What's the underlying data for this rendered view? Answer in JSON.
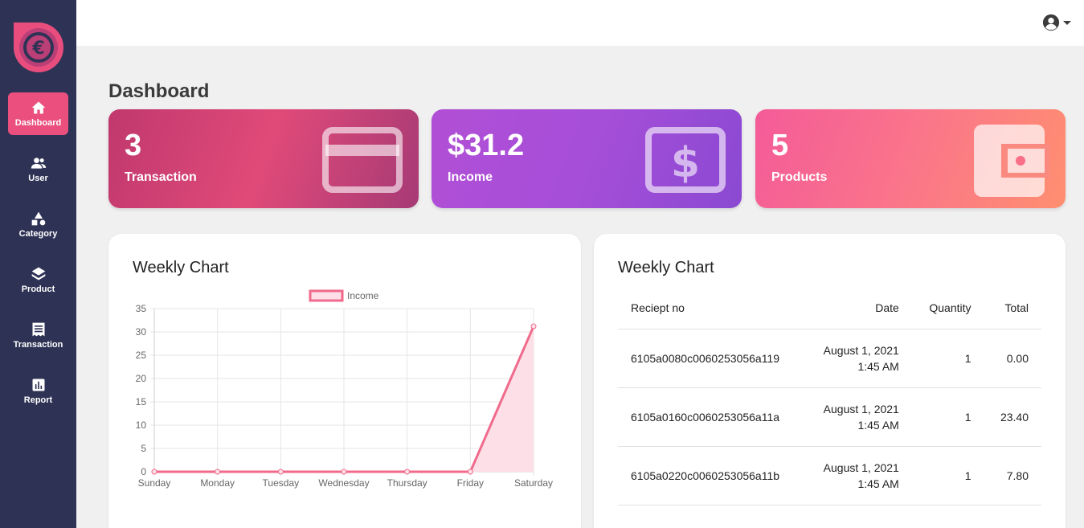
{
  "sidebar": {
    "items": [
      {
        "label": "Dashboard",
        "icon": "home-icon",
        "active": true
      },
      {
        "label": "User",
        "icon": "users-icon"
      },
      {
        "label": "Category",
        "icon": "shapes-icon"
      },
      {
        "label": "Product",
        "icon": "layers-icon"
      },
      {
        "label": "Transaction",
        "icon": "receipt-icon"
      },
      {
        "label": "Report",
        "icon": "chart-bar-icon"
      }
    ]
  },
  "page": {
    "title": "Dashboard"
  },
  "stats": [
    {
      "value": "3",
      "label": "Transaction",
      "icon": "credit-card-icon"
    },
    {
      "value": "$31.2",
      "label": "Income",
      "icon": "dollar-box-icon"
    },
    {
      "value": "5",
      "label": "Products",
      "icon": "wallet-icon"
    }
  ],
  "left_panel": {
    "title": "Weekly Chart"
  },
  "right_panel": {
    "title": "Weekly Chart",
    "columns": [
      "Reciept no",
      "Date",
      "Quantity",
      "Total"
    ],
    "rows": [
      {
        "receipt": "6105a0080c0060253056a119",
        "date1": "August 1, 2021",
        "date2": "1:45 AM",
        "quantity": "1",
        "total": "0.00"
      },
      {
        "receipt": "6105a0160c0060253056a11a",
        "date1": "August 1, 2021",
        "date2": "1:45 AM",
        "quantity": "1",
        "total": "23.40"
      },
      {
        "receipt": "6105a0220c0060253056a11b",
        "date1": "August 1, 2021",
        "date2": "1:45 AM",
        "quantity": "1",
        "total": "7.80"
      }
    ]
  },
  "colors": {
    "sidebar": "#2e3355",
    "accent": "#ea4f7e",
    "line": "#f06a8c",
    "fill": "#fde0e7"
  },
  "chart_data": {
    "type": "line",
    "categories": [
      "Sunday",
      "Monday",
      "Tuesday",
      "Wednesday",
      "Thursday",
      "Friday",
      "Saturday"
    ],
    "series": [
      {
        "name": "Income",
        "values": [
          0,
          0,
          0,
          0,
          0,
          0,
          31.2
        ]
      }
    ],
    "yticks": [
      0,
      5,
      10,
      15,
      20,
      25,
      30,
      35
    ],
    "ylim": [
      0,
      35
    ],
    "grid": true,
    "legend": "top-center"
  }
}
